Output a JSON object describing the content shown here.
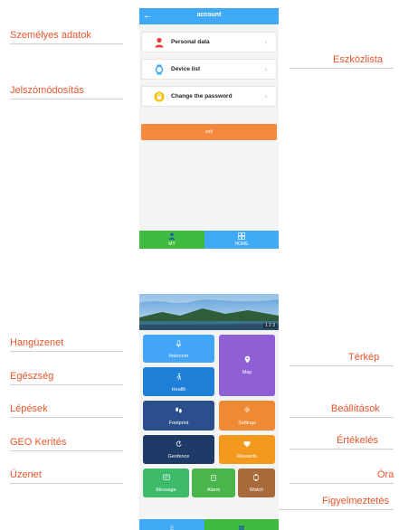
{
  "annotations": {
    "personal": "Személyes adatok",
    "device_list": "Eszközlista",
    "password": "Jelszómódosítás",
    "voice": "Hangüzenet",
    "health": "Egészség",
    "steps": "Lépések",
    "geo": "GEO Kerítés",
    "message": "Üzenet",
    "map": "Térkép",
    "settings": "Beállítások",
    "rating": "Értékelés",
    "watch": "Óra",
    "alarm": "Figyelmeztetés"
  },
  "account_screen": {
    "title": "account",
    "back_icon": "arrow-left-icon",
    "rows": [
      {
        "label": "Personal data",
        "icon": "person-icon",
        "color": "#e8413a"
      },
      {
        "label": "Device list",
        "icon": "watch-icon",
        "color": "#3fa9f5"
      },
      {
        "label": "Change the password",
        "icon": "lock-icon",
        "color": "#f5c518"
      }
    ],
    "exit_label": "exit",
    "nav": {
      "my": "MY",
      "home": "HOME"
    }
  },
  "home_screen": {
    "page_indicator": "1 2 3",
    "tiles": {
      "intercom": "Intercom",
      "map": "Map",
      "health": "Health",
      "footprint": "Footprint",
      "settings": "Settings",
      "geofence": "Geofence",
      "rewards": "Rewards",
      "message": "Message",
      "alarm": "Alarm",
      "watch": "Watch"
    }
  },
  "colors": {
    "header_blue": "#3fa9f5",
    "exit_orange": "#f58a3e",
    "nav_green": "#3ebb3e",
    "tile_light_blue": "#42a5f5",
    "tile_purple": "#8f5fd6",
    "tile_blue": "#1e7fd8",
    "tile_navy": "#2b4f8c",
    "tile_orange": "#ef8a34",
    "tile_dark_navy": "#1d3b66",
    "tile_amber": "#f39a1e",
    "tile_green": "#3dbb6b",
    "tile_green2": "#49b54a",
    "tile_brown": "#a86a3a",
    "annotation_red": "#e8542a"
  }
}
